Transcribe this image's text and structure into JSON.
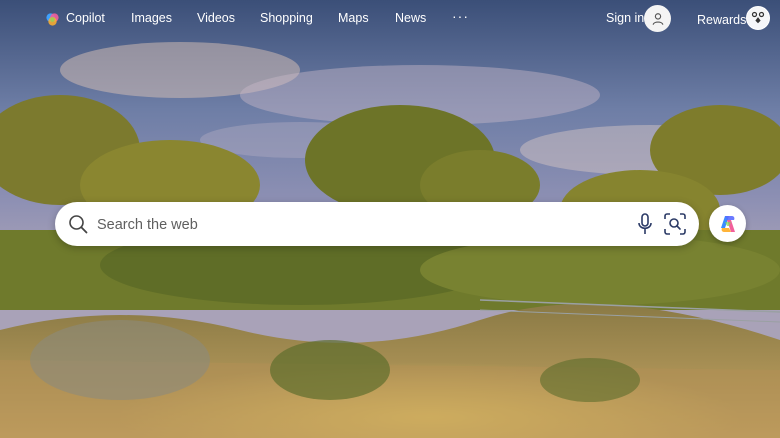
{
  "nav": {
    "copilot": "Copilot",
    "images": "Images",
    "videos": "Videos",
    "shopping": "Shopping",
    "maps": "Maps",
    "news": "News",
    "more": "···"
  },
  "header": {
    "sign_in": "Sign in",
    "rewards": "Rewards"
  },
  "search": {
    "placeholder": "Search the web",
    "value": ""
  },
  "icons": {
    "search": "search-icon",
    "microphone": "microphone-icon",
    "visual_search": "visual-search-icon",
    "copilot": "copilot-icon",
    "avatar": "person-icon",
    "rewards": "rewards-icon"
  },
  "colors": {
    "nav_text": "#ffffff",
    "search_bg": "#ffffff",
    "icon": "#2b3a66"
  }
}
